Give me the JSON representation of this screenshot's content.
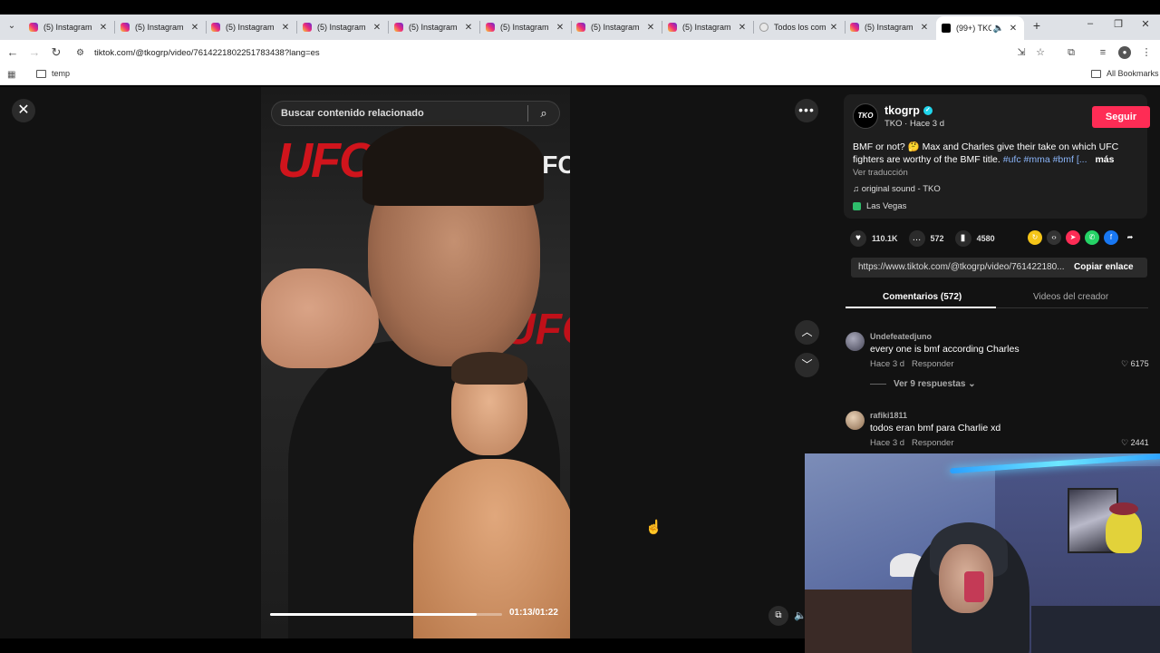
{
  "browser": {
    "tabs": [
      {
        "title": "(5) Instagram",
        "favicon": "instagram-icon"
      },
      {
        "title": "(5) Instagram",
        "favicon": "instagram-icon"
      },
      {
        "title": "(5) Instagram",
        "favicon": "instagram-icon"
      },
      {
        "title": "(5) Instagram",
        "favicon": "instagram-icon"
      },
      {
        "title": "(5) Instagram",
        "favicon": "instagram-icon"
      },
      {
        "title": "(5) Instagram",
        "favicon": "instagram-icon"
      },
      {
        "title": "(5) Instagram",
        "favicon": "instagram-icon"
      },
      {
        "title": "(5) Instagram",
        "favicon": "instagram-icon"
      },
      {
        "title": "Todos los com",
        "favicon": "globe-icon"
      },
      {
        "title": "(5) Instagram",
        "favicon": "instagram-icon"
      },
      {
        "title": "(99+) TKO",
        "favicon": "tiktok-icon",
        "active": true
      }
    ],
    "url": "tiktok.com/@tkogrp/video/7614221802251783438?lang=es",
    "bookmarks": {
      "folder": "temp",
      "all_bookmarks": "All Bookmarks"
    }
  },
  "video": {
    "search_placeholder": "Buscar contenido relacionado",
    "time": "01:13/01:22",
    "progress": 0.89
  },
  "post": {
    "avatar_text": "TKO",
    "username": "tkogrp",
    "meta": "TKO · Hace 3 d",
    "follow_label": "Seguir",
    "desc_text": "BMF or not? 🤔 Max and Charles give their take on which UFC fighters are worthy of the BMF title.",
    "desc_tags": "#ufc #mma #bmf [...",
    "desc_more": "más",
    "translate": "Ver traducción",
    "sound": "original sound - TKO",
    "location": "Las Vegas",
    "likes": "110.1K",
    "comments": "572",
    "saves": "4580",
    "link": "https://www.tiktok.com/@tkogrp/video/761422180...",
    "copy_label": "Copiar enlace",
    "tab_comments": "Comentarios (572)",
    "tab_creator": "Videos del creador"
  },
  "comments": [
    {
      "user": "Undefeatedjuno",
      "text": "every one is bmf according Charles",
      "time": "Hace 3 d",
      "reply": "Responder",
      "likes": "6175",
      "replies": "Ver 9 respuestas"
    },
    {
      "user": "rafiki1811",
      "text": "todos eran bmf para Charlie xd",
      "time": "Hace 3 d",
      "reply": "Responder",
      "likes": "2441"
    }
  ],
  "colors": {
    "follow": "#fe2c55",
    "verified": "#20d5ec",
    "hashtag": "#8ab4f8"
  },
  "video_overlay": {
    "ufc_logo_text": "UFC"
  }
}
